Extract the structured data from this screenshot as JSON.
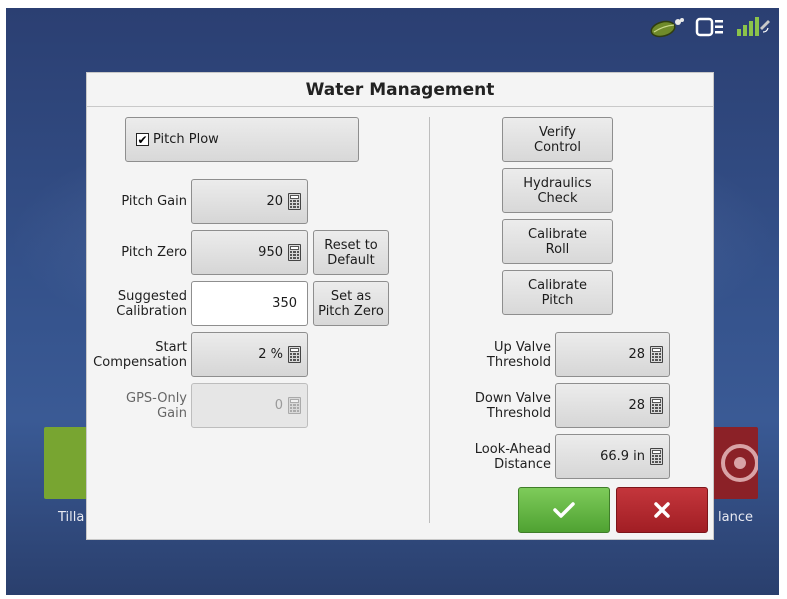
{
  "dialog": {
    "title": "Water Management"
  },
  "left": {
    "pitch_plow": {
      "label": "Pitch Plow",
      "checked": true
    },
    "pitch_gain": {
      "label": "Pitch Gain",
      "value": "20"
    },
    "pitch_zero": {
      "label": "Pitch Zero",
      "value": "950"
    },
    "reset_default": "Reset to\nDefault",
    "suggested_calibration": {
      "label": "Suggested\nCalibration",
      "value": "350"
    },
    "set_pitch_zero": "Set as\nPitch Zero",
    "start_compensation": {
      "label": "Start\nCompensation",
      "value": "2 %"
    },
    "gps_only_gain": {
      "label": "GPS-Only\nGain",
      "value": "0"
    }
  },
  "right": {
    "verify_control": "Verify\nControl",
    "hydraulics_check": "Hydraulics\nCheck",
    "calibrate_roll": "Calibrate\nRoll",
    "calibrate_pitch": "Calibrate\nPitch",
    "up_valve": {
      "label": "Up Valve\nThreshold",
      "value": "28"
    },
    "down_valve": {
      "label": "Down Valve\nThreshold",
      "value": "28"
    },
    "look_ahead": {
      "label": "Look-Ahead\nDistance",
      "value": "66.9 in"
    }
  },
  "actions": {
    "ok_icon": "checkmark-icon",
    "cancel_icon": "x-icon",
    "ok_color": "#5aab3a",
    "cancel_color": "#b1262c"
  },
  "background": {
    "left_tile_label": "Tilla",
    "right_tile_label": "lance",
    "left_tile_color": "#78a531",
    "right_tile_color": "#8b2127"
  },
  "status_bar": {
    "icons": [
      "leaf-icon",
      "display-device-icon",
      "gps-signal-icon"
    ]
  }
}
